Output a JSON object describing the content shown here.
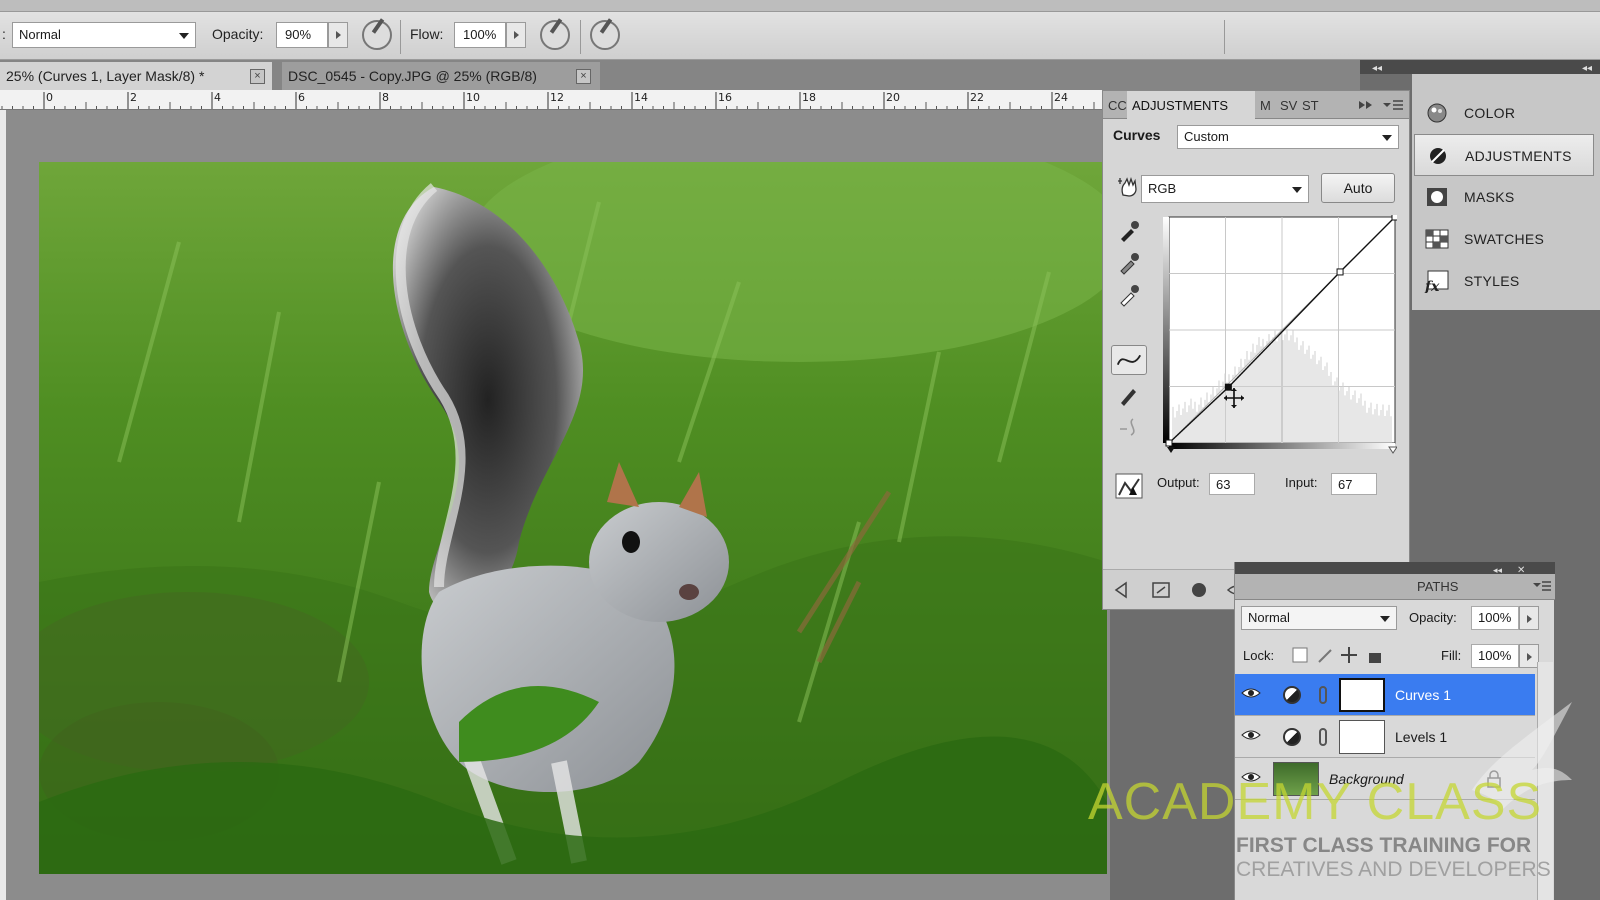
{
  "options_bar": {
    "mode_prefix": ":",
    "mode_value": "Normal",
    "opacity_label": "Opacity:",
    "opacity_value": "90%",
    "flow_label": "Flow:",
    "flow_value": "100%"
  },
  "doc_tabs": [
    {
      "label": "25% (Curves 1, Layer Mask/8) *",
      "close": "×",
      "active": true
    },
    {
      "label": "DSC_0545 - Copy.JPG @ 25% (RGB/8)",
      "close": "×",
      "active": false
    }
  ],
  "ruler": {
    "ticks": [
      "0",
      "2",
      "4",
      "6",
      "8",
      "10",
      "12",
      "14",
      "16",
      "18",
      "20",
      "22",
      "24"
    ]
  },
  "adjustments": {
    "tabs": [
      "CC",
      "ADJUSTMENTS",
      "M",
      "SV",
      "ST"
    ],
    "title": "Curves",
    "preset": "Custom",
    "channel": "RGB",
    "auto_label": "Auto",
    "output_label": "Output:",
    "output_value": "63",
    "input_label": "Input:",
    "input_value": "67",
    "curve_points": [
      {
        "input": 0,
        "output": 0
      },
      {
        "input": 67,
        "output": 63
      },
      {
        "input": 193,
        "output": 193
      },
      {
        "input": 255,
        "output": 255
      }
    ]
  },
  "dock": {
    "items": [
      {
        "label": "COLOR",
        "icon": "color-wheel-icon",
        "active": false
      },
      {
        "label": "ADJUSTMENTS",
        "icon": "adjustments-icon",
        "active": true
      },
      {
        "label": "MASKS",
        "icon": "mask-icon",
        "active": false
      },
      {
        "label": "SWATCHES",
        "icon": "swatches-icon",
        "active": false
      },
      {
        "label": "STYLES",
        "icon": "fx-icon",
        "active": false
      }
    ]
  },
  "layers": {
    "tab": "PATHS",
    "blend_mode": "Normal",
    "opacity_label": "Opacity:",
    "opacity_value": "100%",
    "lock_label": "Lock:",
    "fill_label": "Fill:",
    "fill_value": "100%",
    "rows": [
      {
        "name": "Curves 1",
        "selected": true,
        "type": "adjustment"
      },
      {
        "name": "Levels 1",
        "selected": false,
        "type": "adjustment"
      },
      {
        "name": "Background",
        "selected": false,
        "type": "background"
      }
    ]
  },
  "watermark": {
    "brand": "ACADEMY CLASS",
    "line1": "FIRST CLASS TRAINING FOR",
    "line2": "CREATIVES AND DEVELOPERS"
  }
}
